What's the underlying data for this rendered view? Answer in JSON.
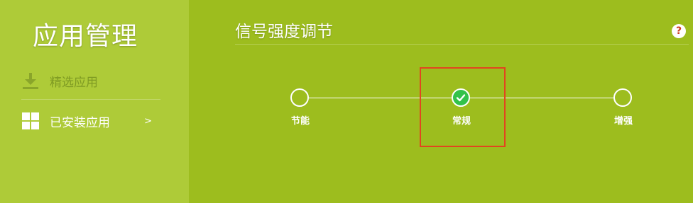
{
  "sidebar": {
    "title": "应用管理",
    "items": [
      {
        "label": "精选应用",
        "icon": "download-icon"
      },
      {
        "label": "已安装应用",
        "icon": "grid-icon",
        "arrow": ">"
      }
    ]
  },
  "main": {
    "title": "信号强度调节",
    "help_symbol": "?",
    "signal_options": [
      {
        "label": "节能",
        "selected": false
      },
      {
        "label": "常规",
        "selected": true
      },
      {
        "label": "增强",
        "selected": false
      }
    ]
  },
  "colors": {
    "sidebar_bg": "#aecb38",
    "main_bg": "#9dbd1e",
    "selected": "#33c24a",
    "highlight": "#e2451f",
    "help_text": "#cc3a1e"
  }
}
